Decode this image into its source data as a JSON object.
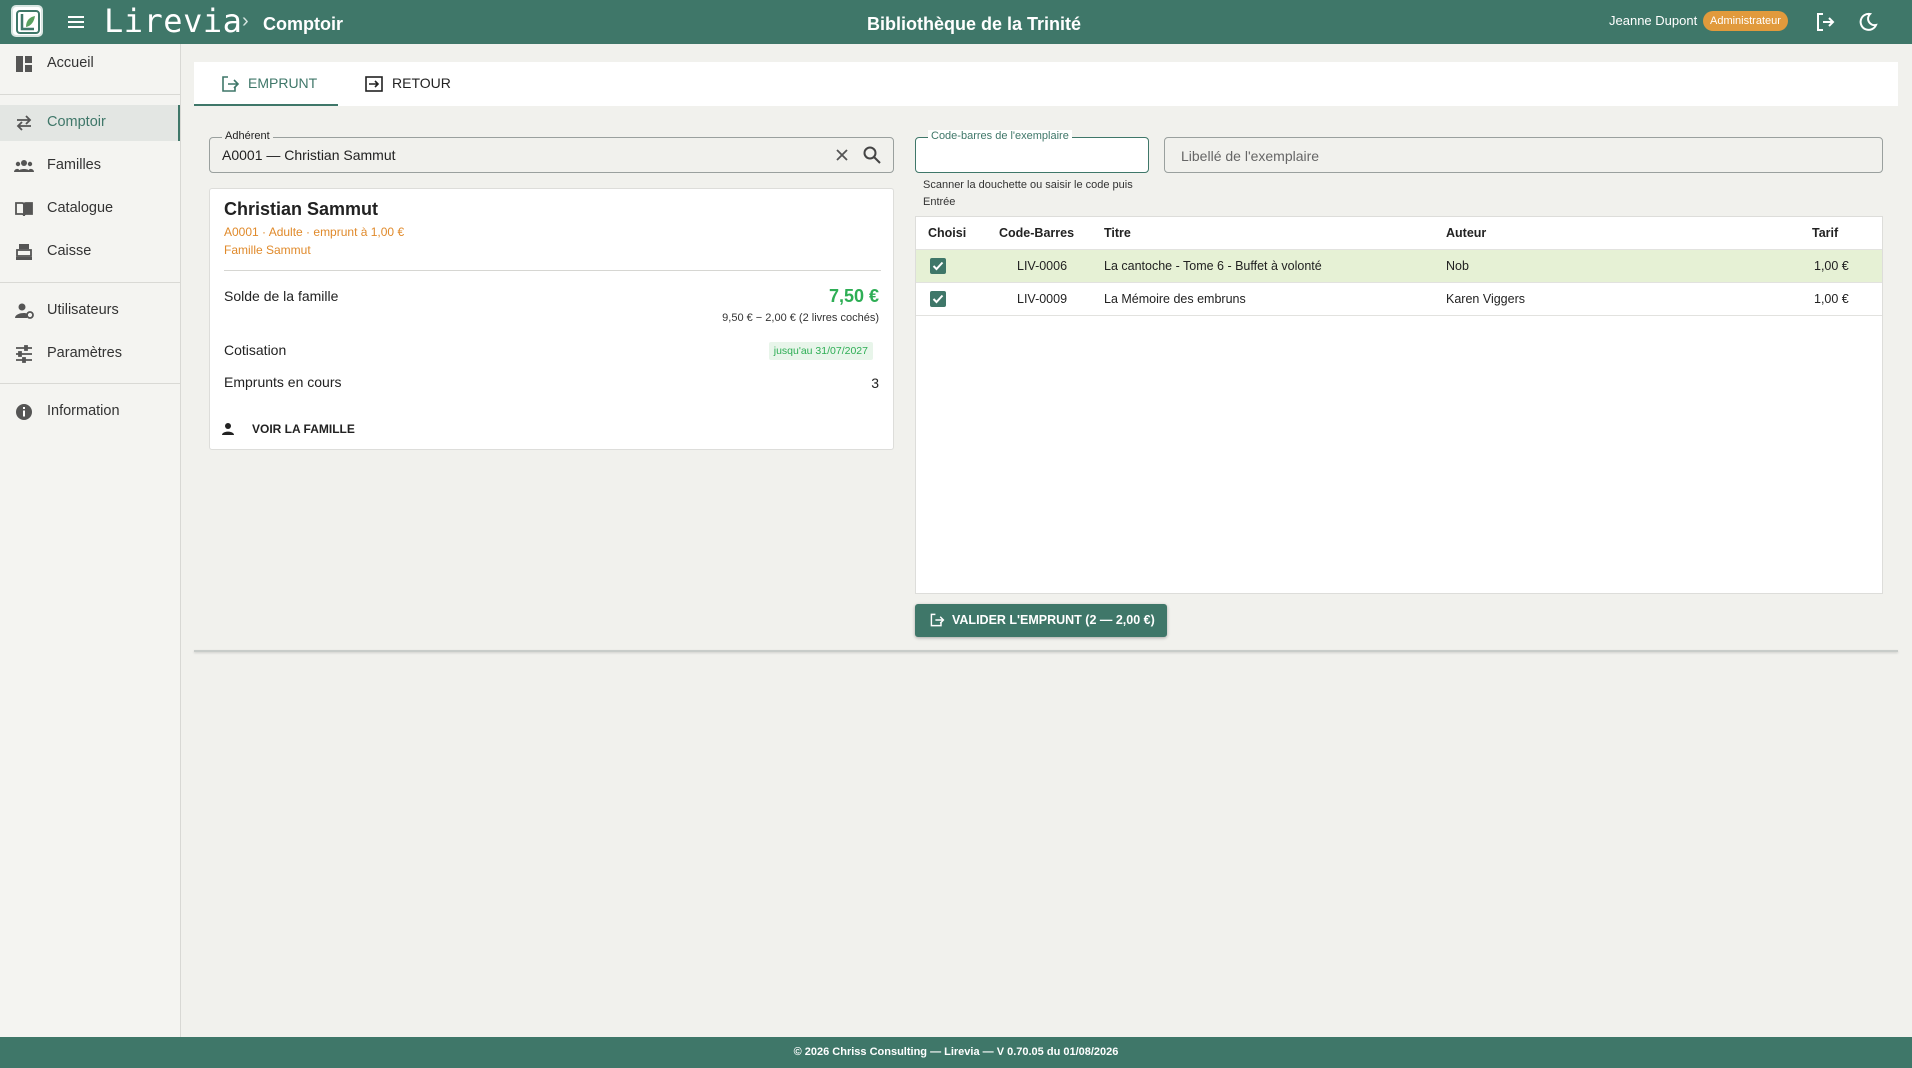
{
  "header": {
    "app_name": "Lirevia",
    "breadcrumb_separator": "›",
    "breadcrumb": "Comptoir",
    "site_title": "Bibliothèque de la Trinité",
    "user_name": "Jeanne Dupont",
    "user_role": "Administrateur",
    "icons": [
      "app-logo",
      "menu-icon",
      "logout-icon",
      "dark-mode-icon"
    ]
  },
  "sidebar": {
    "items": [
      {
        "label": "Accueil",
        "icon": "dashboard-icon",
        "active": false
      },
      {
        "label": "Comptoir",
        "icon": "swap-arrows-icon",
        "active": true
      },
      {
        "label": "Familles",
        "icon": "people-icon",
        "active": false
      },
      {
        "label": "Catalogue",
        "icon": "book-icon",
        "active": false
      },
      {
        "label": "Caisse",
        "icon": "cash-register-icon",
        "active": false
      },
      {
        "label": "Utilisateurs",
        "icon": "user-settings-icon",
        "active": false
      },
      {
        "label": "Paramètres",
        "icon": "tune-icon",
        "active": false
      },
      {
        "label": "Information",
        "icon": "info-icon",
        "active": false
      }
    ]
  },
  "tabs": [
    {
      "label": "EMPRUNT",
      "icon": "checkout-icon",
      "active": true
    },
    {
      "label": "RETOUR",
      "icon": "return-icon",
      "active": false
    }
  ],
  "member_search": {
    "legend": "Adhérent",
    "value": "A0001 — Christian Sammut"
  },
  "member_card": {
    "name": "Christian Sammut",
    "meta": "A0001 · Adulte · emprunt à 1,00 €",
    "family": "Famille Sammut",
    "balance_label": "Solde de la famille",
    "balance_value": "7,50 €",
    "balance_detail": "9,50 € − 2,00 € (2 livres cochés)",
    "membership_label": "Cotisation",
    "membership_badge": "jusqu'au 31/07/2027",
    "loans_label": "Emprunts en cours",
    "loans_count": "3",
    "family_link": "VOIR LA FAMILLE"
  },
  "barcode": {
    "legend": "Code-barres de l'exemplaire",
    "value": "",
    "help": "Scanner la douchette ou saisir le code puis Entrée"
  },
  "item_label": {
    "placeholder": "Libellé de l'exemplaire"
  },
  "table": {
    "headers": [
      "Choisi",
      "Code-Barres",
      "Titre",
      "Auteur",
      "Tarif"
    ],
    "rows": [
      {
        "checked": true,
        "barcode": "LIV-0006",
        "title": "La cantoche - Tome 6 - Buffet à volonté",
        "author": "Nob",
        "price": "1,00 €"
      },
      {
        "checked": true,
        "barcode": "LIV-0009",
        "title": "La Mémoire des embruns",
        "author": "Karen Viggers",
        "price": "1,00 €"
      }
    ]
  },
  "validate_button": {
    "label": "VALIDER L'EMPRUNT (2 — 2,00 €)"
  },
  "footer": {
    "text": "© 2026 Chriss Consulting — Lirevia — V 0.70.05 du 01/08/2026"
  },
  "colors": {
    "primary": "#3f7769",
    "accent_orange": "#e08a2b",
    "success_green": "#2eae55",
    "row_highlight": "#e6f1d5",
    "background": "#f1f1ed"
  }
}
